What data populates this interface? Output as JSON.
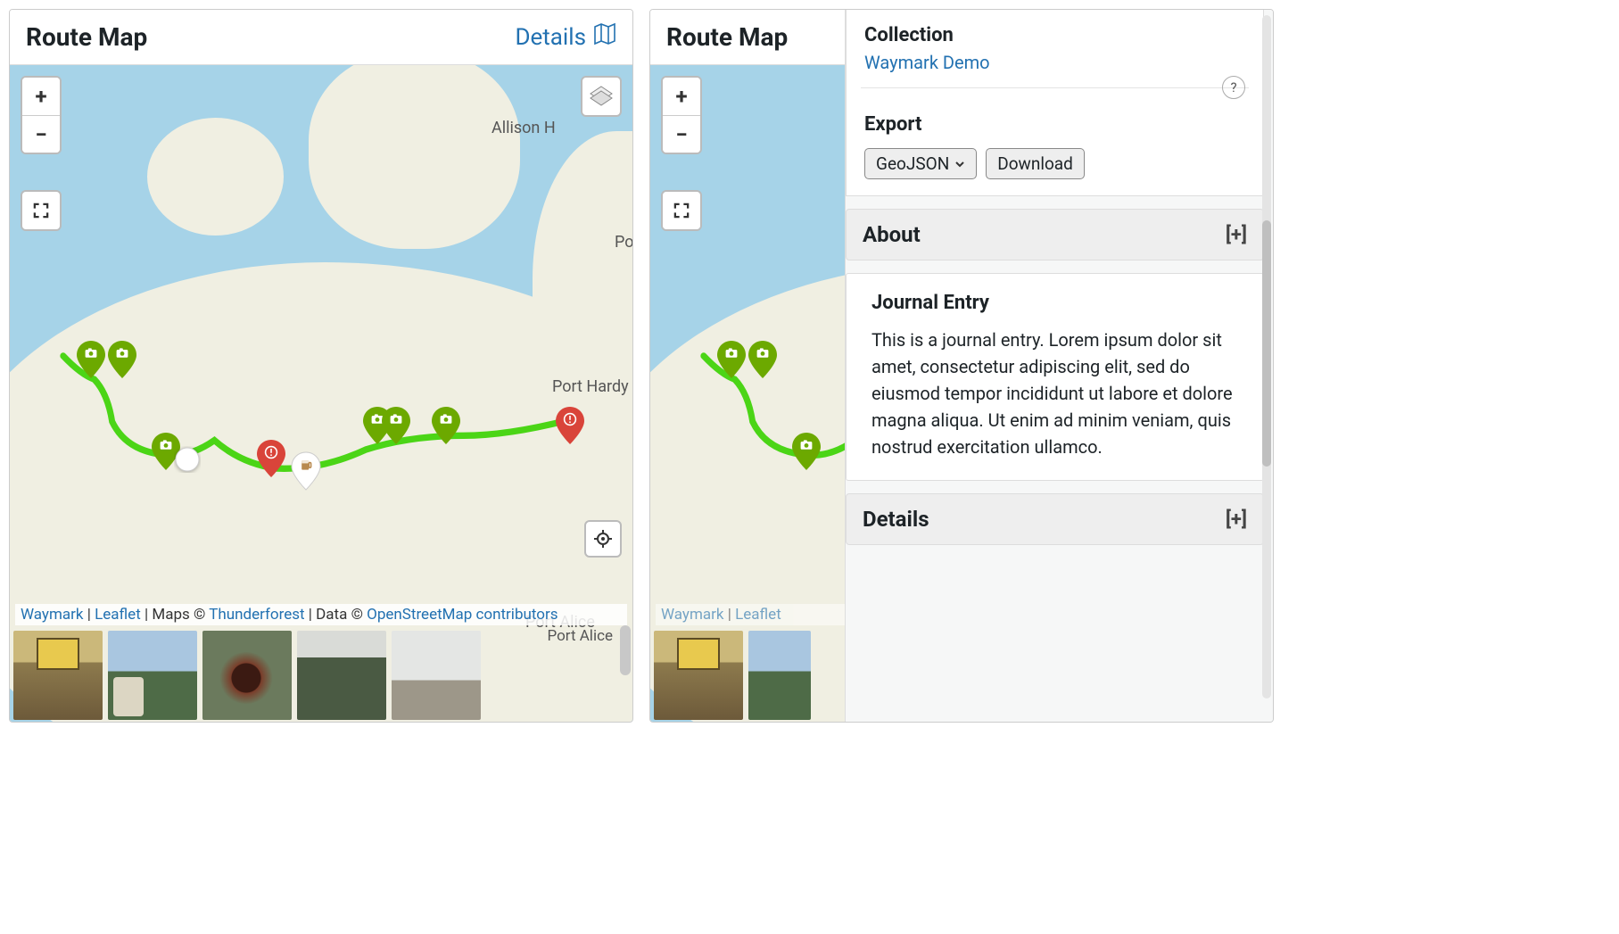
{
  "panel": {
    "title": "Route Map",
    "details_link": "Details"
  },
  "map": {
    "labels": {
      "allison": "Allison H",
      "port_hardy": "Port Hardy",
      "port_alice": "Port Alice",
      "port_right": "Po"
    },
    "attribution": {
      "waymark": "Waymark",
      "leaflet": "Leaflet",
      "maps": "Maps ©",
      "thunderforest": "Thunderforest",
      "data": "Data ©",
      "osm": "OpenStreetMap contributors",
      "sep": " | "
    },
    "controls": {
      "zoom_in": "+",
      "zoom_out": "−"
    }
  },
  "overlay": {
    "collection_label": "Collection",
    "collection_link": "Waymark Demo",
    "export_label": "Export",
    "export_format": "GeoJSON",
    "download": "Download",
    "help": "?",
    "about": {
      "title": "About",
      "toggle": "[+]"
    },
    "journal": {
      "title": "Journal Entry",
      "body": "This is a journal entry. Lorem ipsum dolor sit amet, consectetur adipiscing elit, sed do eiusmod tempor incididunt ut labore et dolore magna aliqua. Ut enim ad minim veniam, quis nostrud exercitation ullamco."
    },
    "details": {
      "title": "Details",
      "toggle": "[+]"
    }
  },
  "markers": [
    {
      "type": "photo",
      "color": "green",
      "x": 13,
      "y": 48
    },
    {
      "type": "photo",
      "color": "green",
      "x": 18,
      "y": 48
    },
    {
      "type": "photo",
      "color": "green",
      "x": 25,
      "y": 61
    },
    {
      "type": "circle",
      "color": "white",
      "x": 28,
      "y": 59
    },
    {
      "type": "alert",
      "color": "red",
      "x": 42,
      "y": 62
    },
    {
      "type": "beer",
      "color": "white",
      "x": 48,
      "y": 64
    },
    {
      "type": "photo",
      "color": "green",
      "x": 60,
      "y": 58
    },
    {
      "type": "photo",
      "color": "green",
      "x": 70,
      "y": 58
    },
    {
      "type": "alert",
      "color": "red",
      "x": 90,
      "y": 57
    }
  ]
}
